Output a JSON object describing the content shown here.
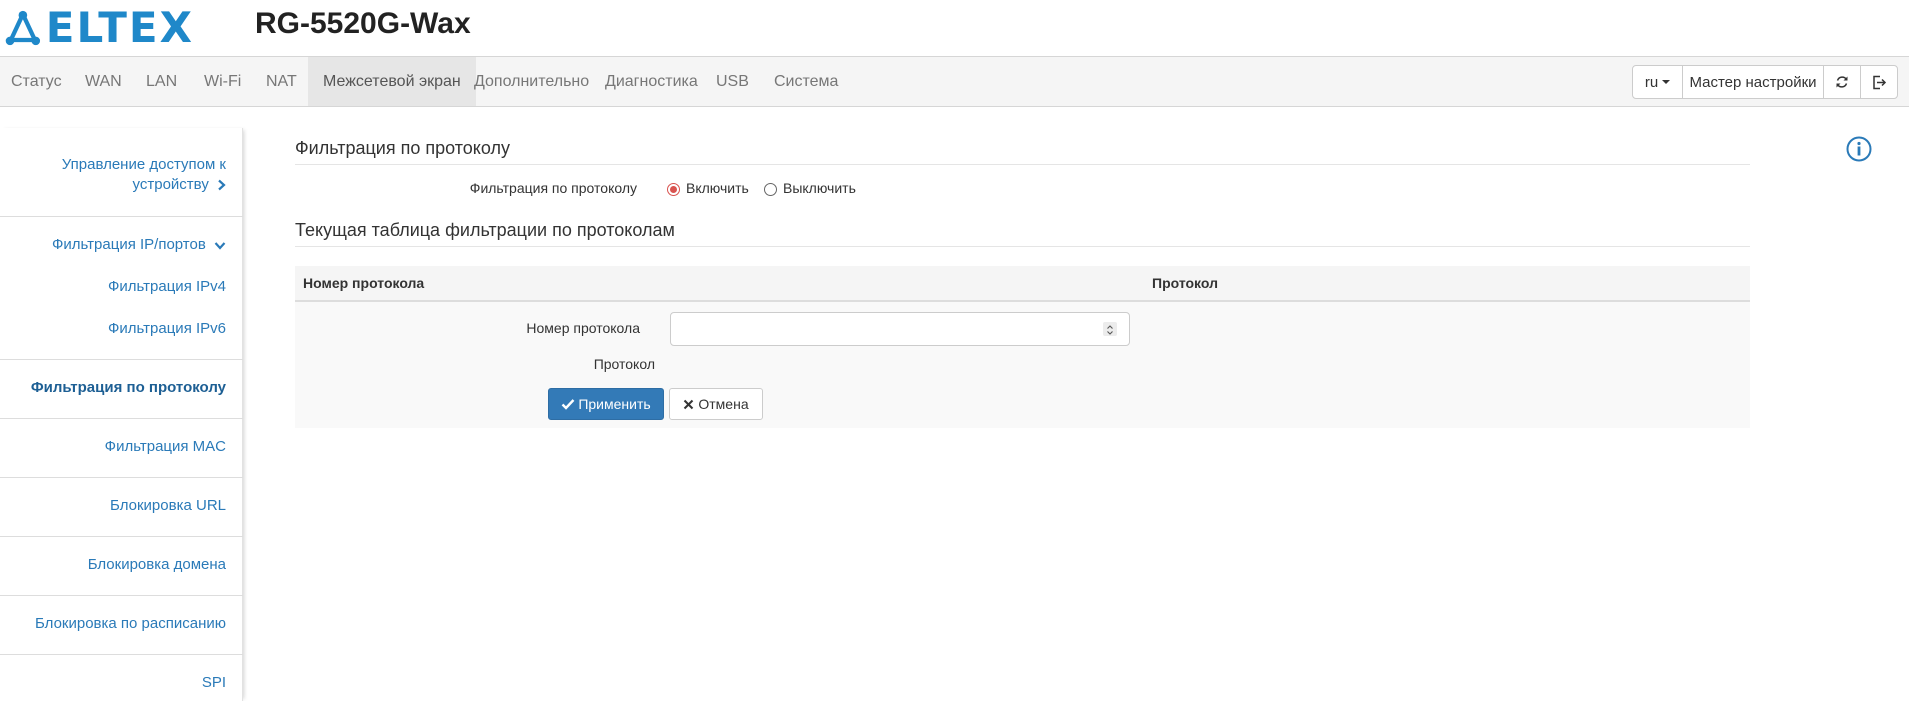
{
  "header": {
    "logo_text": "ELTEX",
    "model": "RG-5520G-Wax"
  },
  "nav": {
    "items": [
      {
        "label": "Статус"
      },
      {
        "label": "WAN"
      },
      {
        "label": "LAN"
      },
      {
        "label": "Wi-Fi"
      },
      {
        "label": "NAT"
      },
      {
        "label": "Межсетевой экран",
        "active": true
      },
      {
        "label": "Дополнительно"
      },
      {
        "label": "Диагностика"
      },
      {
        "label": "USB"
      },
      {
        "label": "Система"
      }
    ],
    "lang": "ru",
    "wizard_label": "Мастер настройки",
    "refresh_icon": "refresh-icon",
    "logout_icon": "logout-icon"
  },
  "sidebar": {
    "items": [
      {
        "label_line1": "Управление доступом к",
        "label_line2": "устройству",
        "icon": "chevron-right-icon"
      },
      {
        "label": "Фильтрация IP/портов",
        "icon": "chevron-down-icon"
      },
      {
        "label": "Фильтрация IPv4"
      },
      {
        "label": "Фильтрация IPv6"
      },
      {
        "label": "Фильтрация по протоколу",
        "active": true
      },
      {
        "label": "Фильтрация MAC"
      },
      {
        "label": "Блокировка URL"
      },
      {
        "label": "Блокировка домена"
      },
      {
        "label": "Блокировка по расписанию"
      },
      {
        "label": "SPI"
      }
    ]
  },
  "main": {
    "section1_title": "Фильтрация по протоколу",
    "filter_label": "Фильтрация по протоколу",
    "radio_on": "Включить",
    "radio_off": "Выключить",
    "radio_selected": "Включить",
    "section2_title": "Текущая таблица фильтрации по протоколам",
    "table": {
      "columns": [
        "Номер протокола",
        "Протокол"
      ]
    },
    "form": {
      "number_label": "Номер протокола",
      "number_value": "",
      "protocol_label": "Протокол",
      "apply_label": "Применить",
      "cancel_label": "Отмена"
    },
    "info_icon": "info-icon"
  },
  "colors": {
    "accent": "#337ab7",
    "link": "#2a7ab8",
    "brand": "#1f88c9",
    "radio_checked": "#d9534f"
  }
}
